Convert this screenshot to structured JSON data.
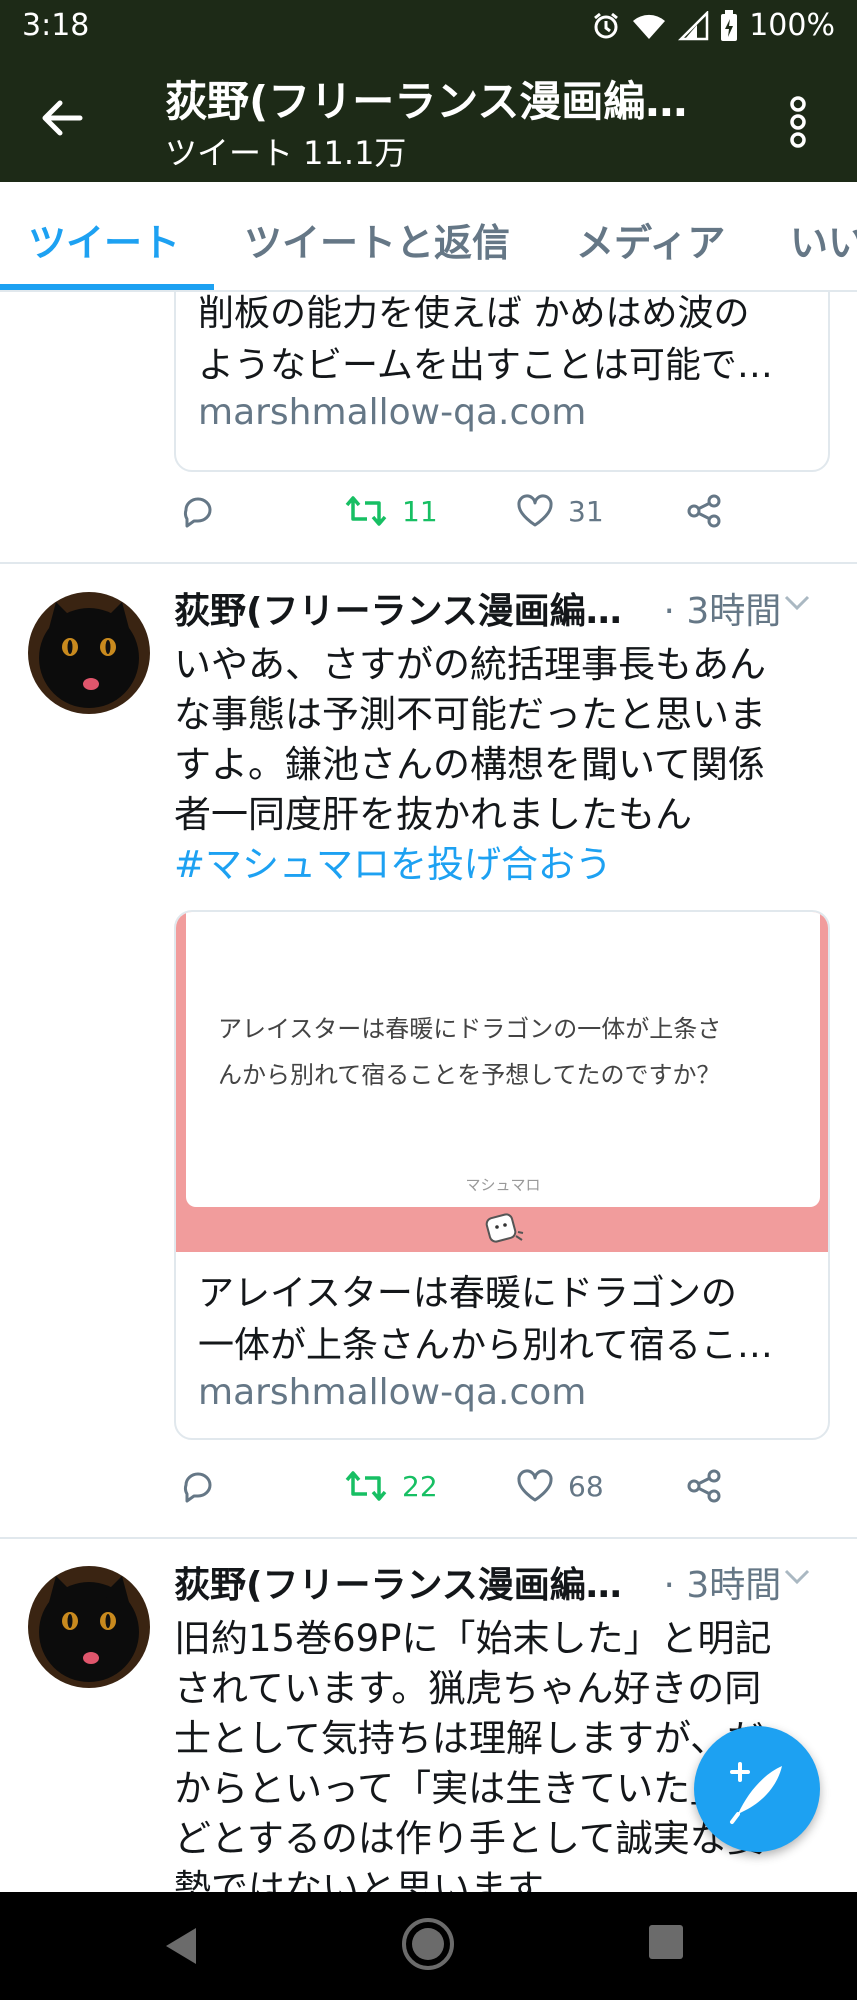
{
  "status_bar": {
    "time": "3:18",
    "battery": "100%",
    "icons": [
      "alarm-icon",
      "wifi-icon",
      "cell-signal-icon",
      "battery-icon"
    ]
  },
  "header": {
    "title": "荻野(フリーランス漫画編集者)",
    "subtitle": "ツイート 11.1万",
    "colors": {
      "background": "#1d2a17"
    }
  },
  "tabs": [
    {
      "label": "ツイート",
      "active": true
    },
    {
      "label": "ツイートと返信",
      "active": false
    },
    {
      "label": "メディア",
      "active": false
    },
    {
      "label": "いいね",
      "active": false
    }
  ],
  "accent_color": "#1da1f2",
  "retweet_color": "#17bf63",
  "tweets": [
    {
      "card": {
        "lines": [
          "削板の能力を使えば かめはめ波の",
          "ようなビームを出すことは可能で…"
        ],
        "domain": "marshmallow-qa.com"
      },
      "retweets": "11",
      "likes": "31"
    },
    {
      "author": "荻野(フリーランス漫画編集者)",
      "time": "· 3時間",
      "lines": [
        "いやあ、さすがの統括理事長もあん",
        "な事態は予測不可能だったと思いま",
        "すよ。鎌池さんの構想を聞いて関係",
        "者一同度肝を抜かれましたもん"
      ],
      "hashtag": "#マシュマロを投げ合おう",
      "card": {
        "image_question_lines": [
          "アレイスターは春暖にドラゴンの一体が上条さ",
          "んから別れて宿ることを予想してたのですか？"
        ],
        "image_brand": "マシュマロ",
        "lines": [
          "アレイスターは春暖にドラゴンの",
          "一体が上条さんから別れて宿るこ…"
        ],
        "domain": "marshmallow-qa.com"
      },
      "retweets": "22",
      "likes": "68"
    },
    {
      "author": "荻野(フリーランス漫画編集者)",
      "time": "· 3時間",
      "lines": [
        "旧約15巻69Pに「始末した」と明記",
        "されています。猟虎ちゃん好きの同",
        "士として気持ちは理解しますが、だ",
        "からといって「実は生きていた」な",
        "どとするのは作り手として誠実な姿",
        "勢ではないと思います"
      ]
    }
  ]
}
